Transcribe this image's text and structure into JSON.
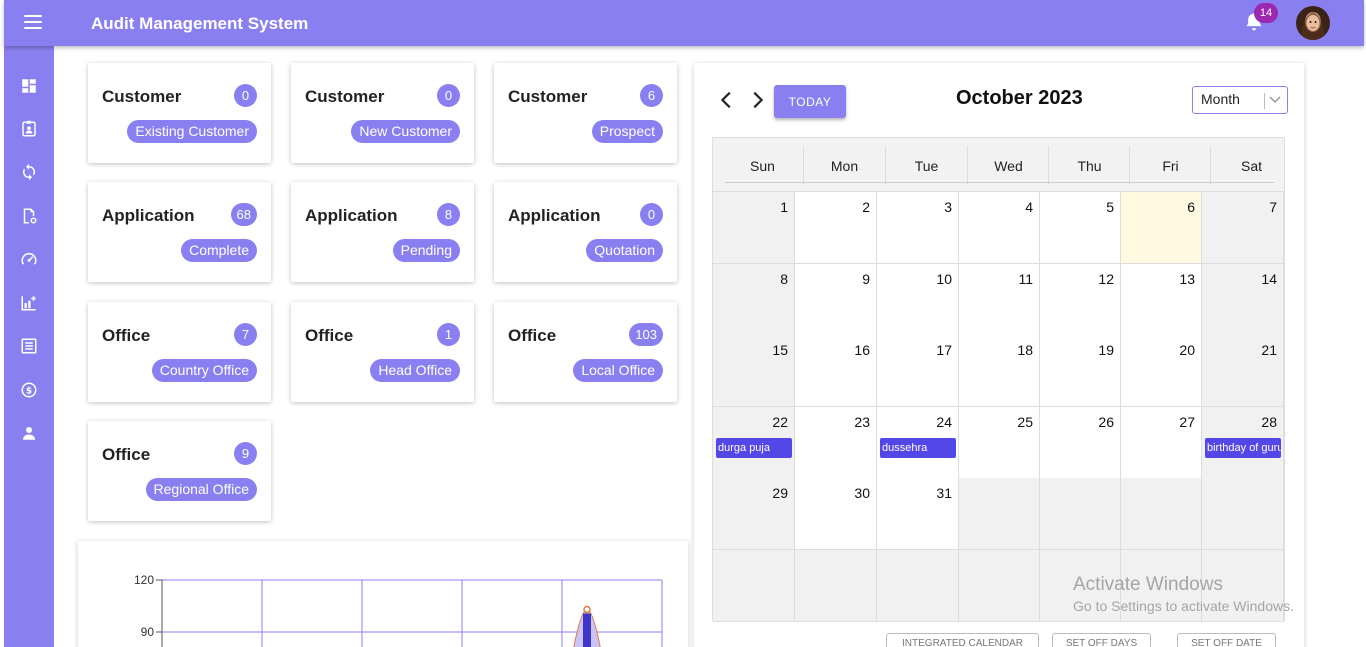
{
  "app": {
    "title": "Audit Management System"
  },
  "header": {
    "notification_count": "14"
  },
  "sidebar": {
    "items": [
      {
        "icon": "dashboard-icon"
      },
      {
        "icon": "contact-badge-icon"
      },
      {
        "icon": "sync-icon"
      },
      {
        "icon": "document-settings-icon"
      },
      {
        "icon": "speedometer-icon"
      },
      {
        "icon": "chart-add-icon"
      },
      {
        "icon": "list-icon"
      },
      {
        "icon": "currency-exchange-icon"
      },
      {
        "icon": "person-icon"
      }
    ]
  },
  "cards": [
    {
      "title": "Customer",
      "count": "0",
      "label": "Existing Customer"
    },
    {
      "title": "Customer",
      "count": "0",
      "label": "New Customer"
    },
    {
      "title": "Customer",
      "count": "6",
      "label": "Prospect"
    },
    {
      "title": "Application",
      "count": "68",
      "label": "Complete"
    },
    {
      "title": "Application",
      "count": "8",
      "label": "Pending"
    },
    {
      "title": "Application",
      "count": "0",
      "label": "Quotation"
    },
    {
      "title": "Office",
      "count": "7",
      "label": "Country Office"
    },
    {
      "title": "Office",
      "count": "1",
      "label": "Head Office"
    },
    {
      "title": "Office",
      "count": "103",
      "label": "Local Office"
    },
    {
      "title": "Office",
      "count": "9",
      "label": "Regional Office"
    }
  ],
  "chart_data": {
    "type": "area",
    "y_ticks": [
      "120",
      "90"
    ],
    "ylim": [
      90,
      120
    ],
    "grid": true,
    "peak": {
      "x_index": 8.6,
      "value": 103
    }
  },
  "calendar": {
    "today_label": "TODAY",
    "month_title": "October 2023",
    "view": "Month",
    "weekdays": [
      "Sun",
      "Mon",
      "Tue",
      "Wed",
      "Thu",
      "Fri",
      "Sat"
    ],
    "weeks": [
      [
        "1",
        "2",
        "3",
        "4",
        "5",
        "6",
        "7"
      ],
      [
        "8",
        "9",
        "10",
        "11",
        "12",
        "13",
        "14"
      ],
      [
        "15",
        "16",
        "17",
        "18",
        "19",
        "20",
        "21"
      ],
      [
        "22",
        "23",
        "24",
        "25",
        "26",
        "27",
        "28"
      ],
      [
        "29",
        "30",
        "31",
        "",
        "",
        "",
        ""
      ],
      [
        "",
        "",
        "",
        "",
        "",
        "",
        ""
      ]
    ],
    "today_date": "6",
    "events": [
      {
        "date": "22",
        "title": "durga puja"
      },
      {
        "date": "24",
        "title": "dussehra"
      },
      {
        "date": "28",
        "title": "birthday of guru"
      }
    ],
    "bottom_buttons": [
      "INTEGRATED CALENDAR",
      "SET OFF DAYS",
      "SET OFF DATE"
    ]
  },
  "watermark": {
    "title": "Activate Windows",
    "subtitle": "Go to Settings to activate Windows."
  },
  "colors": {
    "primary": "#8a7ff0",
    "event": "#5447e8",
    "badge": "#9c27b0",
    "today_bg": "#fff9e1"
  }
}
